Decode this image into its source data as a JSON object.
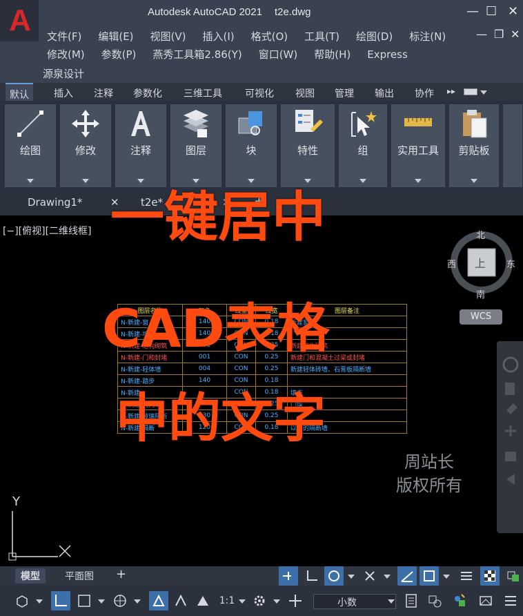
{
  "window": {
    "app_title": "Autodesk AutoCAD 2021",
    "file_title": "t2e.dwg",
    "logo_letter": "A",
    "minimize": "—",
    "maximize": "☐",
    "close": "✕",
    "doc_minimize": "—",
    "doc_restore": "❐",
    "doc_close": "✕"
  },
  "menu": {
    "row1": [
      "文件(F)",
      "编辑(E)",
      "视图(V)",
      "插入(I)",
      "格式(O)",
      "工具(T)",
      "绘图(D)",
      "标注(N)"
    ],
    "row2": [
      "修改(M)",
      "参数(P)",
      "燕秀工具箱2.86(Y)",
      "窗口(W)",
      "帮助(H)",
      "Express"
    ],
    "row3": [
      "源泉设计"
    ]
  },
  "ribbon_tabs": [
    "默认",
    "插入",
    "注释",
    "参数化",
    "三维工具",
    "可视化",
    "视图",
    "管理",
    "输出",
    "协作"
  ],
  "ribbon_tabs_more": "▸▸",
  "ribbon_panels": [
    {
      "label": "绘图",
      "icon": "line-icon"
    },
    {
      "label": "修改",
      "icon": "move-icon"
    },
    {
      "label": "注释",
      "icon": "text-icon"
    },
    {
      "label": "图层",
      "icon": "layers-icon"
    },
    {
      "label": "块",
      "icon": "block-icon"
    },
    {
      "label": "特性",
      "icon": "properties-icon"
    },
    {
      "label": "组",
      "icon": "group-icon"
    },
    {
      "label": "实用工具",
      "icon": "measure-icon"
    },
    {
      "label": "剪贴板",
      "icon": "clipboard-icon"
    }
  ],
  "file_tabs": [
    {
      "label": "Drawing1*",
      "close": "✕"
    },
    {
      "label": "t2e*",
      "close": "✕"
    }
  ],
  "new_tab": "+",
  "viewport": {
    "label": "[−][俯视][二维线框]",
    "compass": {
      "north": "北",
      "south": "南",
      "east": "东",
      "west": "西",
      "top": "上"
    },
    "wcs": "WCS"
  },
  "cad_table": {
    "header": [
      "图层名称",
      "颜色",
      "线型",
      "线宽",
      "图层备注"
    ],
    "rows": [
      {
        "name": "N-新建-窗",
        "color": "140",
        "linetype": "CON",
        "width": "0.18",
        "note": "新建窗洞",
        "red": false
      },
      {
        "name": "N-新建-墙台",
        "color": "140",
        "linetype": "CON",
        "width": "0.18",
        "note": "",
        "red": false
      },
      {
        "name": "N-新建-结构砌筑",
        "color": "001",
        "linetype": "CON",
        "width": "0.25",
        "note": "新建结构砌筑",
        "red": true
      },
      {
        "name": "N-新建-门和封堵",
        "color": "001",
        "linetype": "CON",
        "width": "0.25",
        "note": "新建门和混凝土过梁或封堵",
        "red": true
      },
      {
        "name": "N-新建-轻体墙",
        "color": "004",
        "linetype": "CON",
        "width": "0.25",
        "note": "新建轻体砖墙、石膏板隔断墙",
        "red": false
      },
      {
        "name": "N-新建-踏步",
        "color": "140",
        "linetype": "CON",
        "width": "0.18",
        "note": "",
        "red": false
      },
      {
        "name": "N-新建-",
        "color": "",
        "linetype": "CON",
        "width": "0.18",
        "note": "填充",
        "red": false
      },
      {
        "name": "N-新建-内门垛",
        "color": "",
        "linetype": "CON",
        "width": "0.25",
        "note": "门垛",
        "red": false
      },
      {
        "name": "N-新建-玻璃隔断",
        "color": "030",
        "linetype": "CON",
        "width": "0.25",
        "note": "",
        "red": false
      },
      {
        "name": "N-新建-隔断",
        "color": "120",
        "linetype": "CON",
        "width": "0.18",
        "note": "以外的隔断墙",
        "red": false
      }
    ]
  },
  "overlay": {
    "line1": "一键居中",
    "line2": "CAD表格",
    "line3": "中的文字"
  },
  "watermark": {
    "line1": "周站长",
    "line2": "版权所有"
  },
  "ucs": {
    "y": "Y",
    "x": "X"
  },
  "model_tabs": {
    "model": "模型",
    "layout": "平面图",
    "add": "+"
  },
  "status": {
    "scale": "1:1",
    "units": "小数"
  },
  "colors": {
    "accent": "#64a0d8",
    "overlay": "#ff4a10",
    "table_border": "#a07a2a",
    "table_cyan": "#4ab0ff",
    "table_header": "#e8e04a"
  }
}
